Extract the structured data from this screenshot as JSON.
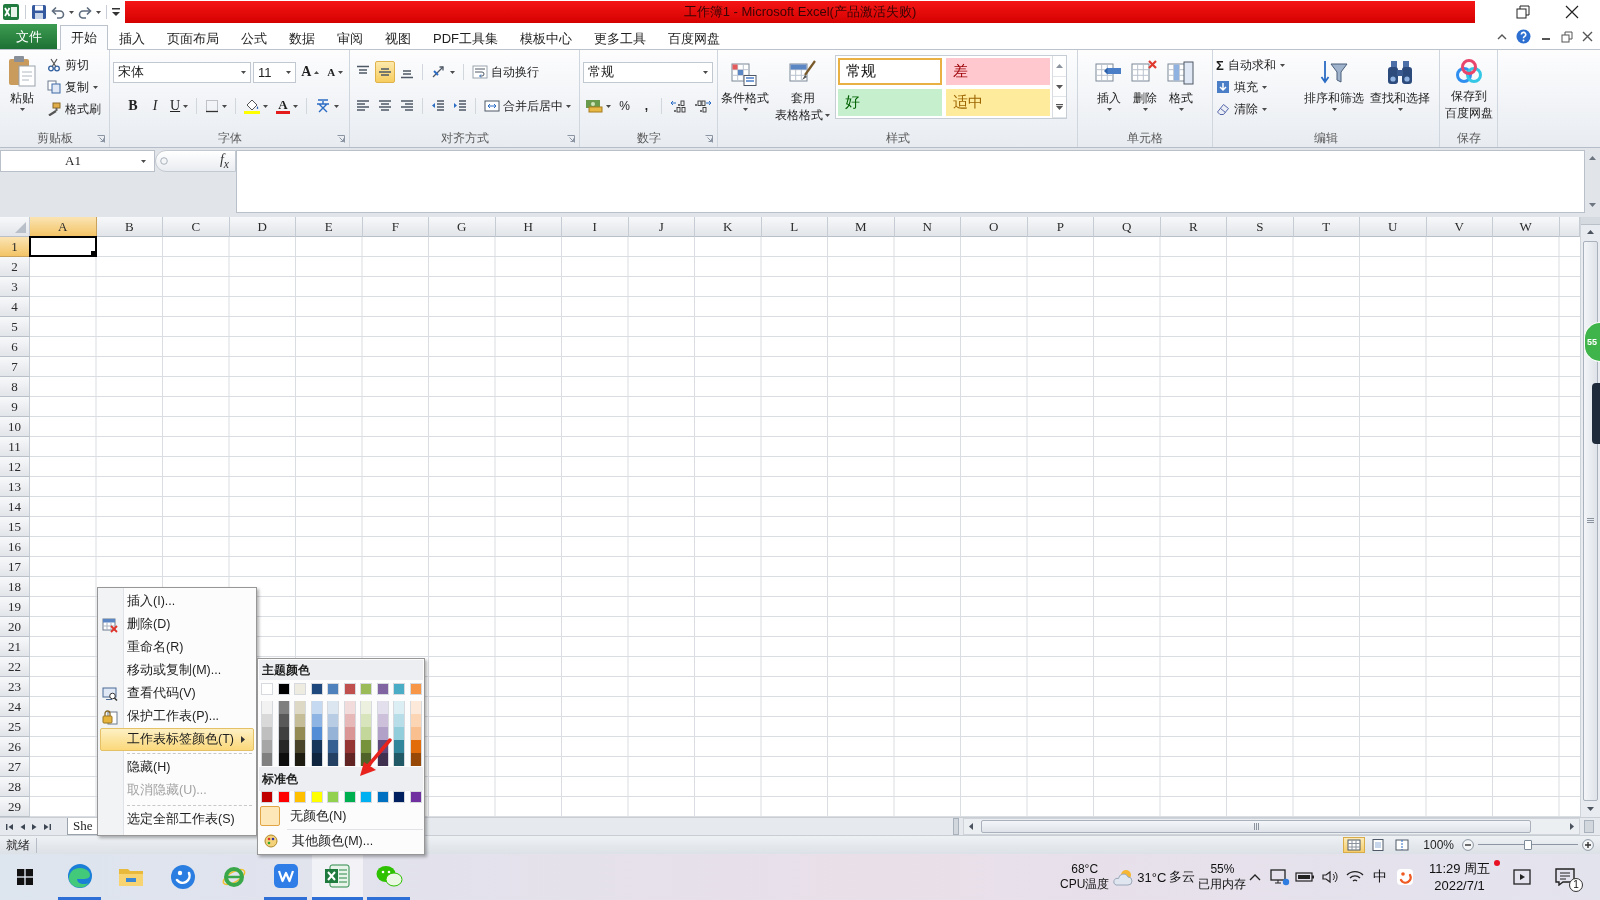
{
  "title_bar": {
    "title": "工作簿1 - Microsoft Excel(产品激活失败)"
  },
  "ribbon_tabs": [
    {
      "label": "文件",
      "kind": "file",
      "selected": false
    },
    {
      "label": "开始",
      "kind": "tab",
      "selected": true
    },
    {
      "label": "插入",
      "kind": "tab",
      "selected": false
    },
    {
      "label": "页面布局",
      "kind": "tab",
      "selected": false
    },
    {
      "label": "公式",
      "kind": "tab",
      "selected": false
    },
    {
      "label": "数据",
      "kind": "tab",
      "selected": false
    },
    {
      "label": "审阅",
      "kind": "tab",
      "selected": false
    },
    {
      "label": "视图",
      "kind": "tab",
      "selected": false
    },
    {
      "label": "PDF工具集",
      "kind": "tab",
      "selected": false
    },
    {
      "label": "模板中心",
      "kind": "tab",
      "selected": false
    },
    {
      "label": "更多工具",
      "kind": "tab",
      "selected": false
    },
    {
      "label": "百度网盘",
      "kind": "tab",
      "selected": false
    }
  ],
  "ribbon": {
    "clipboard": {
      "label": "剪贴板",
      "paste": "粘贴",
      "items": [
        {
          "label": "剪切",
          "dropdown": false
        },
        {
          "label": "复制",
          "dropdown": true
        },
        {
          "label": "格式刷",
          "dropdown": false
        }
      ]
    },
    "font": {
      "label": "字体",
      "font_name": "宋体",
      "font_size": "11",
      "grow": "A",
      "shrink": "A",
      "bold": "B",
      "italic": "I",
      "underline": "U",
      "font_color": "A"
    },
    "alignment": {
      "label": "对齐方式",
      "vertical_align": [
        {
          "selected": false
        },
        {
          "selected": true
        },
        {
          "selected": false
        }
      ],
      "horizontal_align": [
        {
          "selected": false
        },
        {
          "selected": false
        },
        {
          "selected": false
        }
      ],
      "wrap": "自动换行",
      "merge": "合并后居中"
    },
    "number": {
      "label": "数字",
      "format": "常规",
      "percent": "%",
      "comma": ","
    },
    "styles": {
      "label": "样式",
      "conditional": "条件格式",
      "table_format": [
        "套用",
        "表格格式"
      ],
      "cell_styles": [
        {
          "label": "常规",
          "kind": "normal",
          "selected": true
        },
        {
          "label": "差",
          "kind": "bad",
          "selected": false
        },
        {
          "label": "好",
          "kind": "good",
          "selected": false
        },
        {
          "label": "适中",
          "kind": "neutral",
          "selected": false
        }
      ]
    },
    "cells": {
      "label": "单元格",
      "buttons": [
        "插入",
        "删除",
        "格式"
      ]
    },
    "editing": {
      "label": "编辑",
      "sum_symbol": "Σ",
      "small": [
        "自动求和",
        "填充",
        "清除"
      ],
      "sort": "排序和筛选",
      "find": "查找和选择"
    },
    "save": {
      "label": "保存",
      "button": [
        "保存到",
        "百度网盘"
      ]
    }
  },
  "formula_bar": {
    "name_box": "A1",
    "function_label": "f$_{x}$"
  },
  "grid": {
    "columns": [
      {
        "label": "A",
        "selected": true
      },
      {
        "label": "B",
        "selected": false
      },
      {
        "label": "C",
        "selected": false
      },
      {
        "label": "D",
        "selected": false
      },
      {
        "label": "E",
        "selected": false
      },
      {
        "label": "F",
        "selected": false
      },
      {
        "label": "G",
        "selected": false
      },
      {
        "label": "H",
        "selected": false
      },
      {
        "label": "I",
        "selected": false
      },
      {
        "label": "J",
        "selected": false
      },
      {
        "label": "K",
        "selected": false
      },
      {
        "label": "L",
        "selected": false
      },
      {
        "label": "M",
        "selected": false
      },
      {
        "label": "N",
        "selected": false
      },
      {
        "label": "O",
        "selected": false
      },
      {
        "label": "P",
        "selected": false
      },
      {
        "label": "Q",
        "selected": false
      },
      {
        "label": "R",
        "selected": false
      },
      {
        "label": "S",
        "selected": false
      },
      {
        "label": "T",
        "selected": false
      },
      {
        "label": "U",
        "selected": false
      },
      {
        "label": "V",
        "selected": false
      },
      {
        "label": "W",
        "selected": false
      }
    ],
    "rows": [
      {
        "label": "1",
        "selected": true
      },
      {
        "label": "2",
        "selected": false
      },
      {
        "label": "3",
        "selected": false
      },
      {
        "label": "4",
        "selected": false
      },
      {
        "label": "5",
        "selected": false
      },
      {
        "label": "6",
        "selected": false
      },
      {
        "label": "7",
        "selected": false
      },
      {
        "label": "8",
        "selected": false
      },
      {
        "label": "9",
        "selected": false
      },
      {
        "label": "10",
        "selected": false
      },
      {
        "label": "11",
        "selected": false
      },
      {
        "label": "12",
        "selected": false
      },
      {
        "label": "13",
        "selected": false
      },
      {
        "label": "14",
        "selected": false
      },
      {
        "label": "15",
        "selected": false
      },
      {
        "label": "16",
        "selected": false
      },
      {
        "label": "17",
        "selected": false
      },
      {
        "label": "18",
        "selected": false
      },
      {
        "label": "19",
        "selected": false
      },
      {
        "label": "20",
        "selected": false
      },
      {
        "label": "21",
        "selected": false
      },
      {
        "label": "22",
        "selected": false
      },
      {
        "label": "23",
        "selected": false
      },
      {
        "label": "24",
        "selected": false
      },
      {
        "label": "25",
        "selected": false
      },
      {
        "label": "26",
        "selected": false
      },
      {
        "label": "27",
        "selected": false
      },
      {
        "label": "28",
        "selected": false
      },
      {
        "label": "29",
        "selected": false
      }
    ]
  },
  "sheet_tabs": [
    {
      "label": "She",
      "selected": true
    }
  ],
  "status_bar": {
    "status": "就绪",
    "views": [
      {
        "selected": true
      },
      {
        "selected": false
      },
      {
        "selected": false
      }
    ],
    "zoom": "100%",
    "zoom_slider": {
      "level": 0.5
    }
  },
  "context_menu": {
    "items": [
      {
        "label": "插入(I)...",
        "kind": "item",
        "selected": false,
        "disabled": false
      },
      {
        "label": "删除(D)",
        "kind": "item",
        "selected": false,
        "disabled": false
      },
      {
        "label": "重命名(R)",
        "kind": "item",
        "selected": false,
        "disabled": false
      },
      {
        "label": "移动或复制(M)...",
        "kind": "item",
        "selected": false,
        "disabled": false
      },
      {
        "label": "查看代码(V)",
        "kind": "item",
        "selected": false,
        "disabled": false
      },
      {
        "label": "保护工作表(P)...",
        "kind": "item",
        "selected": false,
        "disabled": false
      },
      {
        "label": "工作表标签颜色(T)",
        "kind": "submenu",
        "selected": true,
        "disabled": false
      },
      {
        "kind": "separator"
      },
      {
        "label": "隐藏(H)",
        "kind": "item",
        "selected": false,
        "disabled": false
      },
      {
        "label": "取消隐藏(U)...",
        "kind": "item",
        "selected": false,
        "disabled": true
      },
      {
        "kind": "separator"
      },
      {
        "label": "选定全部工作表(S)",
        "kind": "item",
        "selected": false,
        "disabled": false
      }
    ]
  },
  "tab_color_menu": {
    "theme_heading": "主题颜色",
    "theme_colors": [
      {
        "color": "#ffffff"
      },
      {
        "color": "#000000"
      },
      {
        "color": "#eeece1"
      },
      {
        "color": "#1f497d"
      },
      {
        "color": "#4f81bd"
      },
      {
        "color": "#c0504d"
      },
      {
        "color": "#9bbb59"
      },
      {
        "color": "#8064a2"
      },
      {
        "color": "#4bacc6"
      },
      {
        "color": "#f79646"
      }
    ],
    "theme_shades": [
      {
        "swatches": [
          {
            "color": "#f2f2f2"
          },
          {
            "color": "#7f7f7f"
          },
          {
            "color": "#ddd9c4"
          },
          {
            "color": "#c5d9f1"
          },
          {
            "color": "#dce6f1"
          },
          {
            "color": "#f2dcdb"
          },
          {
            "color": "#ebf1de"
          },
          {
            "color": "#e4dfec"
          },
          {
            "color": "#daeef3"
          },
          {
            "color": "#fde9d9"
          }
        ]
      },
      {
        "swatches": [
          {
            "color": "#d9d9d9"
          },
          {
            "color": "#595959"
          },
          {
            "color": "#c4bd97"
          },
          {
            "color": "#8db4e2"
          },
          {
            "color": "#b8cce4"
          },
          {
            "color": "#e6b8b7"
          },
          {
            "color": "#d8e4bc"
          },
          {
            "color": "#ccc0da"
          },
          {
            "color": "#b7dee8"
          },
          {
            "color": "#fcd5b4"
          }
        ]
      },
      {
        "swatches": [
          {
            "color": "#bfbfbf"
          },
          {
            "color": "#404040"
          },
          {
            "color": "#948a54"
          },
          {
            "color": "#538dd5"
          },
          {
            "color": "#95b3d7"
          },
          {
            "color": "#da9694"
          },
          {
            "color": "#c4d79b"
          },
          {
            "color": "#b1a0c7"
          },
          {
            "color": "#92cddc"
          },
          {
            "color": "#fabf8f"
          }
        ]
      },
      {
        "swatches": [
          {
            "color": "#a6a6a6"
          },
          {
            "color": "#262626"
          },
          {
            "color": "#4a452a"
          },
          {
            "color": "#16365c"
          },
          {
            "color": "#366092"
          },
          {
            "color": "#963634"
          },
          {
            "color": "#76933c"
          },
          {
            "color": "#60497a"
          },
          {
            "color": "#31869b"
          },
          {
            "color": "#e26b0a"
          }
        ]
      },
      {
        "swatches": [
          {
            "color": "#808080"
          },
          {
            "color": "#0d0d0d"
          },
          {
            "color": "#1e1c11"
          },
          {
            "color": "#0f243e"
          },
          {
            "color": "#244062"
          },
          {
            "color": "#632523"
          },
          {
            "color": "#4f6228"
          },
          {
            "color": "#403151"
          },
          {
            "color": "#215967"
          },
          {
            "color": "#974706"
          }
        ]
      }
    ],
    "standard_heading": "标准色",
    "standard_colors": [
      {
        "color": "#c00000"
      },
      {
        "color": "#ff0000"
      },
      {
        "color": "#ffc000"
      },
      {
        "color": "#ffff00"
      },
      {
        "color": "#92d050"
      },
      {
        "color": "#00b050"
      },
      {
        "color": "#00b0f0"
      },
      {
        "color": "#0070c0"
      },
      {
        "color": "#002060"
      },
      {
        "color": "#7030a0"
      }
    ],
    "no_color": {
      "label": "无颜色(N)",
      "checked": true
    },
    "more_colors": {
      "label": "其他颜色(M)..."
    }
  },
  "side_widget": {
    "badge": "55"
  },
  "taskbar": {
    "apps": [
      {
        "running": true,
        "selected": false
      },
      {
        "running": false,
        "selected": false
      },
      {
        "running": false,
        "selected": false
      },
      {
        "running": false,
        "selected": false
      },
      {
        "running": true,
        "selected": false
      },
      {
        "running": true,
        "selected": true
      },
      {
        "running": true,
        "selected": false
      }
    ],
    "tray": {
      "cpu_temp": "68°C",
      "cpu_label": "CPU温度",
      "weather_temp": "31°C",
      "weather_text": "多云",
      "memory": "55%",
      "memory_label": "已用内存",
      "ime": "中",
      "time": "11:29 周五",
      "date": "2022/7/1",
      "notifications": "1"
    }
  }
}
